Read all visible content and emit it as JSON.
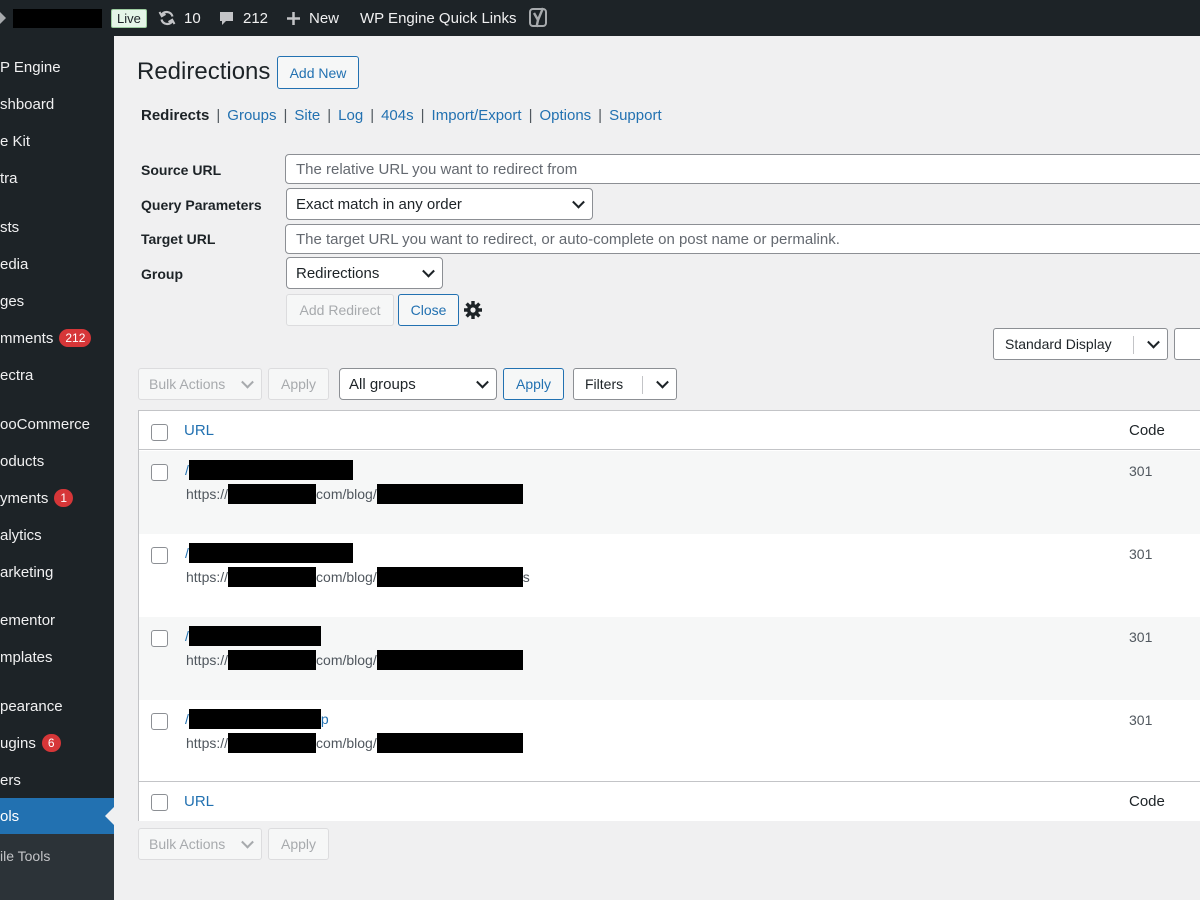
{
  "adminbar": {
    "live_label": "Live",
    "updates_count": "10",
    "comments_count": "212",
    "new_label": "New",
    "quick_links_label": "WP Engine Quick Links"
  },
  "sidebar": {
    "items": [
      {
        "label": "P Engine"
      },
      {
        "label": "shboard"
      },
      {
        "label": "e Kit"
      },
      {
        "label": "tra"
      },
      {
        "label": "sts"
      },
      {
        "label": "edia"
      },
      {
        "label": "ges"
      },
      {
        "label": "mments",
        "badge": "212"
      },
      {
        "label": "ectra"
      },
      {
        "label": "ooCommerce"
      },
      {
        "label": "oducts"
      },
      {
        "label": "yments",
        "badge": "1"
      },
      {
        "label": "alytics"
      },
      {
        "label": "arketing"
      },
      {
        "label": "ementor"
      },
      {
        "label": "mplates"
      },
      {
        "label": "pearance"
      },
      {
        "label": "ugins",
        "badge": "6"
      },
      {
        "label": "ers"
      },
      {
        "label": "ols"
      },
      {
        "label": "ile Tools"
      }
    ]
  },
  "page": {
    "title": "Redirections",
    "add_new_label": "Add New"
  },
  "subnav": {
    "active": "Redirects",
    "links": [
      "Groups",
      "Site",
      "Log",
      "404s",
      "Import/Export",
      "Options",
      "Support"
    ]
  },
  "form": {
    "source_label": "Source URL",
    "source_placeholder": "The relative URL you want to redirect from",
    "query_label": "Query Parameters",
    "query_value": "Exact match in any order",
    "target_label": "Target URL",
    "target_placeholder": "The target URL you want to redirect, or auto-complete on post name or permalink.",
    "group_label": "Group",
    "group_value": "Redirections",
    "add_redirect_label": "Add Redirect",
    "close_label": "Close"
  },
  "display": {
    "value": "Standard Display"
  },
  "tablenav": {
    "bulk_actions": "Bulk Actions",
    "apply": "Apply",
    "groups_value": "All groups",
    "apply_filter": "Apply",
    "filters_label": "Filters"
  },
  "table": {
    "col_url": "URL",
    "col_code": "Code",
    "rows": [
      {
        "source_prefix": "/",
        "source_suffix": "",
        "target_prefix": "https://",
        "target_mid": "com/blog/",
        "target_suffix": "",
        "code": "301"
      },
      {
        "source_prefix": "/",
        "source_suffix": "",
        "target_prefix": "https://",
        "target_mid": "com/blog/",
        "target_suffix": "s",
        "code": "301"
      },
      {
        "source_prefix": "/",
        "source_suffix": "",
        "target_prefix": "https://",
        "target_mid": "com/blog/",
        "target_suffix": "",
        "code": "301"
      },
      {
        "source_prefix": "/",
        "source_suffix": "p",
        "target_prefix": "https://",
        "target_mid": "com/blog/",
        "target_suffix": "",
        "code": "301"
      }
    ]
  },
  "colors": {
    "accent": "#2271b1",
    "admin_bg": "#1d2327",
    "badge": "#d63638"
  }
}
